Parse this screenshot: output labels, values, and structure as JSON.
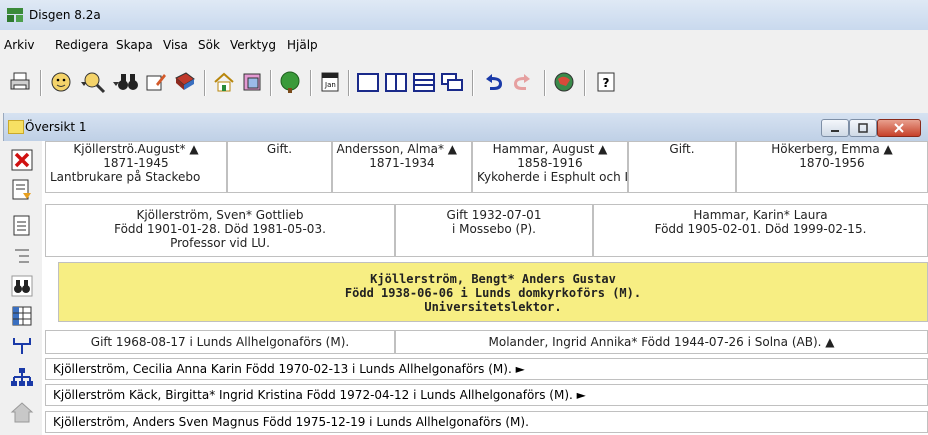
{
  "window": {
    "title": "Disgen 8.2a"
  },
  "menu": [
    "Arkiv",
    "Redigera",
    "Skapa",
    "Visa",
    "Sök",
    "Verktyg",
    "Hjälp"
  ],
  "child_window": {
    "title": "Översikt 1"
  },
  "grandparents": [
    {
      "name": "Kjöllerströ.August* ▲",
      "years": "1871-1945",
      "note": "Lantbrukare på Stackebo"
    },
    {
      "name": "Gift.",
      "years": "",
      "note": ""
    },
    {
      "name": "Andersson, Alma* ▲",
      "years": "1871-1934",
      "note": ""
    },
    {
      "name": "Hammar, August ▲",
      "years": "1858-1916",
      "note": "Kykoherde i Esphult och I"
    },
    {
      "name": "Gift.",
      "years": "",
      "note": ""
    },
    {
      "name": "Hökerberg, Emma ▲",
      "years": "1870-1956",
      "note": ""
    }
  ],
  "parents": {
    "father": {
      "line1": "Kjöllerström, Sven* Gottlieb",
      "line2": "Född 1901-01-28. Död 1981-05-03.",
      "line3": "Professor vid LU."
    },
    "marriage": {
      "line1": "Gift 1932-07-01",
      "line2": "i Mossebo (P)."
    },
    "mother": {
      "line1": "Hammar, Karin* Laura",
      "line2": "Född 1905-02-01. Död 1999-02-15."
    }
  },
  "main_person": {
    "line1": "Kjöllerström, Bengt* Anders Gustav",
    "line2": "Född 1938-06-06 i Lunds domkyrkoförs (M).",
    "line3": "Universitetslektor."
  },
  "spouse_row": {
    "marriage": "Gift 1968-08-17 i Lunds Allhelgonaförs (M).",
    "spouse": "Molander, Ingrid Annika* Född 1944-07-26 i Solna (AB). ▲"
  },
  "children": [
    "Kjöllerström, Cecilia Anna Karin Född 1970-02-13 i Lunds Allhelgonaförs (M). ►",
    "Kjöllerström Käck, Birgitta* Ingrid Kristina Född 1972-04-12 i Lunds Allhelgonaförs (M). ►",
    "Kjöllerström, Anders Sven Magnus Född 1975-12-19 i Lunds Allhelgonaförs (M)."
  ],
  "icons": {
    "toolbar": [
      "print-icon",
      "person-icon",
      "person-search-icon",
      "binoculars-icon",
      "edit-hand-icon",
      "book-icon",
      "home-icon",
      "notes-icon",
      "tree-icon",
      "calendar-icon",
      "layout-single-icon",
      "layout-two-icon",
      "layout-rows-icon",
      "layout-overlap-icon",
      "undo-icon",
      "redo-icon",
      "globe-person-icon",
      "help-icon"
    ],
    "sidebar": [
      "close-red-x-icon",
      "report-icon",
      "document-icon",
      "outline-icon",
      "binoculars-icon",
      "table-icon",
      "descendants-icon",
      "family-tree-icon",
      "house-icon"
    ]
  }
}
